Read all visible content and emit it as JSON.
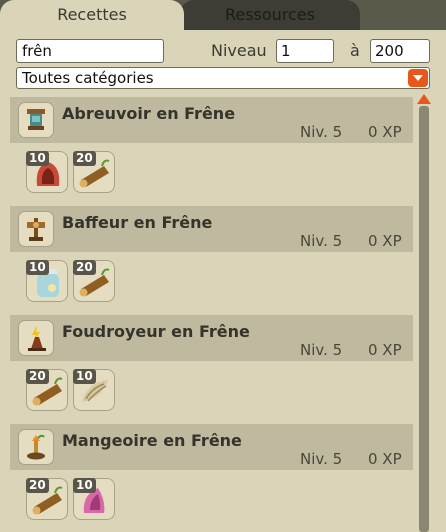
{
  "tabs": {
    "recettes": "Recettes",
    "ressources": "Ressources"
  },
  "filters": {
    "search_value": "frên",
    "niveau_label": "Niveau",
    "min_level": "1",
    "a_label": "à",
    "max_level": "200",
    "category": "Toutes catégories"
  },
  "colors": {
    "accent": "#e8581a",
    "panel": "#dad5b9",
    "header_row": "#bfb9a0"
  },
  "recipes": [
    {
      "name": "Abreuvoir en Frêne",
      "level": "Niv. 5",
      "xp": "0 XP",
      "icon": "trough-icon",
      "ingredients": [
        {
          "qty": "10",
          "icon": "red-hide-icon"
        },
        {
          "qty": "20",
          "icon": "ash-log-icon"
        }
      ]
    },
    {
      "name": "Baffeur en Frêne",
      "level": "Niv. 5",
      "xp": "0 XP",
      "icon": "slapper-icon",
      "ingredients": [
        {
          "qty": "10",
          "icon": "jar-icon"
        },
        {
          "qty": "20",
          "icon": "ash-log-icon"
        }
      ]
    },
    {
      "name": "Foudroyeur en Frêne",
      "level": "Niv. 5",
      "xp": "0 XP",
      "icon": "lightning-totem-icon",
      "ingredients": [
        {
          "qty": "20",
          "icon": "ash-log-icon"
        },
        {
          "qty": "10",
          "icon": "shell-icon"
        }
      ]
    },
    {
      "name": "Mangeoire en Frêne",
      "level": "Niv. 5",
      "xp": "0 XP",
      "icon": "feeder-icon",
      "ingredients": [
        {
          "qty": "20",
          "icon": "ash-log-icon"
        },
        {
          "qty": "10",
          "icon": "pink-ear-icon"
        }
      ]
    }
  ]
}
